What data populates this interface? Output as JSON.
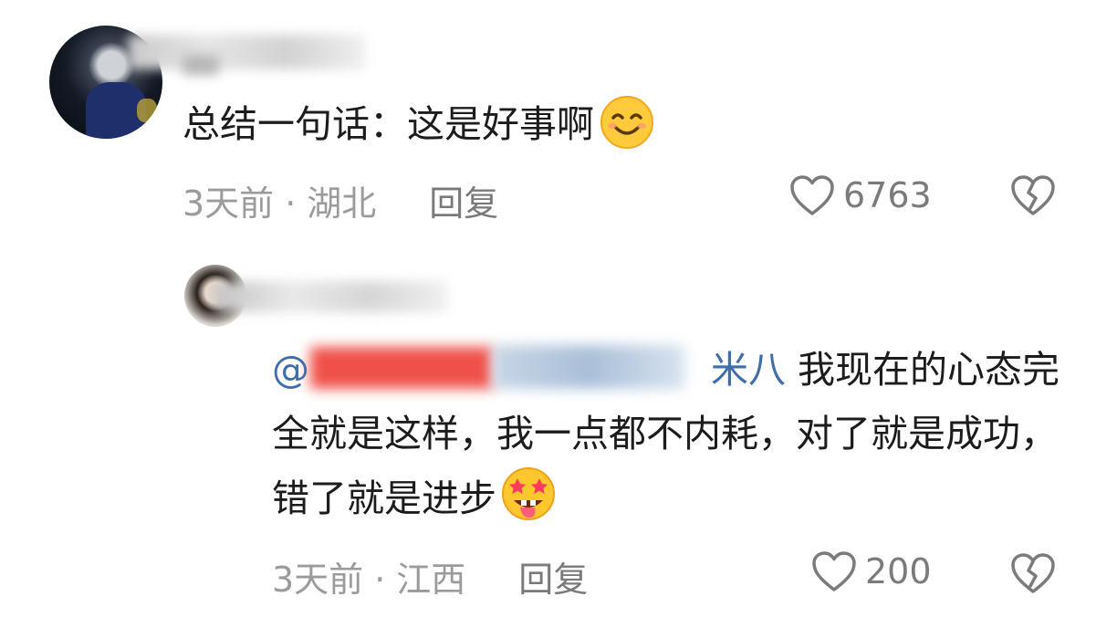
{
  "comment": {
    "text": "总结一句话：这是好事啊",
    "emoji": "smiling-face-emoji",
    "meta": {
      "time": "3天前",
      "separator": "·",
      "location": "湖北",
      "reply_label": "回复"
    },
    "likes": "6763"
  },
  "reply": {
    "mention_prefix": "@",
    "mention_suffix": "米八",
    "text": "我现在的心态完全就是这样，我一点都不内耗，对了就是成功，错了就是进步",
    "emoji": "star-struck-tongue-emoji",
    "meta": {
      "time": "3天前",
      "separator": "·",
      "location": "江西",
      "reply_label": "回复"
    },
    "likes": "200"
  },
  "icons": {
    "like": "heart-outline-icon",
    "dislike": "broken-heart-icon"
  },
  "colors": {
    "text": "#1c1c1c",
    "meta": "#9b9b9b",
    "mention": "#3f6ea9"
  }
}
